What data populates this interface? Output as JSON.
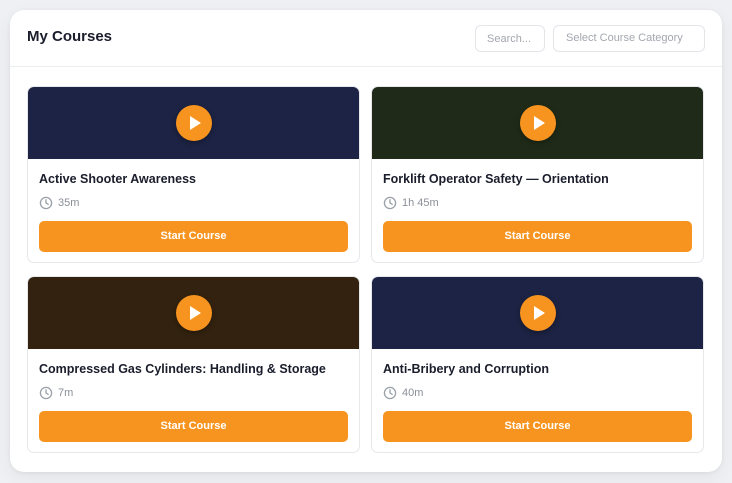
{
  "header": {
    "title": "My Courses",
    "search_placeholder": "Search...",
    "category_placeholder": "Select Course Category"
  },
  "colors": {
    "accent": "#f79420",
    "thumb_navy": "#1c2344",
    "thumb_green": "#1f2b18",
    "thumb_brown": "#33220f"
  },
  "courses": [
    {
      "title": "Active Shooter Awareness",
      "duration": "35m",
      "thumb_color": "#1c2344",
      "button": "Start Course",
      "icon": "play-icon"
    },
    {
      "title": "Forklift Operator Safety — Orientation",
      "duration": "1h 45m",
      "thumb_color": "#1f2b18",
      "button": "Start Course",
      "icon": "play-icon"
    },
    {
      "title": "Compressed Gas Cylinders: Handling & Storage",
      "duration": "7m",
      "thumb_color": "#33220f",
      "button": "Start Course",
      "icon": "play-icon"
    },
    {
      "title": "Anti-Bribery and Corruption",
      "duration": "40m",
      "thumb_color": "#1c2344",
      "button": "Start Course",
      "icon": "play-icon"
    }
  ]
}
